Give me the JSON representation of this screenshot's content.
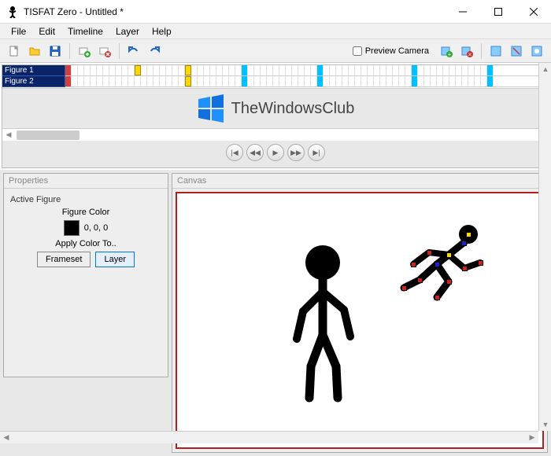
{
  "window": {
    "title": "TISFAT Zero - Untitled *"
  },
  "menu": {
    "file": "File",
    "edit": "Edit",
    "timeline": "Timeline",
    "layer": "Layer",
    "help": "Help"
  },
  "toolbar": {
    "preview_camera_label": "Preview Camera",
    "preview_camera_checked": false
  },
  "timeline": {
    "layers": [
      "Figure 1",
      "Figure 2"
    ]
  },
  "watermark": {
    "text": "TheWindowsClub"
  },
  "properties": {
    "panel_title": "Properties",
    "group_label": "Active Figure",
    "figure_color_label": "Figure Color",
    "figure_color_value": "0, 0, 0",
    "apply_label": "Apply Color To..",
    "btn_frameset": "Frameset",
    "btn_layer": "Layer"
  },
  "canvas": {
    "panel_title": "Canvas"
  }
}
